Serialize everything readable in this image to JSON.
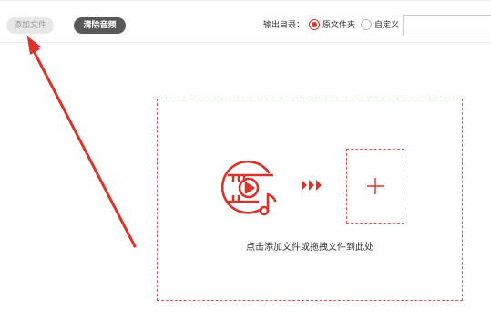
{
  "toolbar": {
    "add_file_label": "添加文件",
    "clear_audio_label": "清除音频",
    "output_dir_label": "输出目录：",
    "radio_source_label": "原文件夹",
    "radio_custom_label": "自定义",
    "output_path_value": "",
    "selected_output": "原文件夹"
  },
  "drop_area": {
    "hint": "点击添加文件或拖拽文件到此处",
    "media_icon": "video-to-audio-icon",
    "arrows_icon": "triple-chevron-right-icon",
    "add_icon": "plus-icon"
  },
  "annotation": {
    "arrow_icon": "red-arrow-annotation-icon",
    "color": "#e0322a"
  },
  "colors": {
    "accent": "#d9342b",
    "dashed_border": "#e05a50",
    "dark_button": "#585858"
  }
}
